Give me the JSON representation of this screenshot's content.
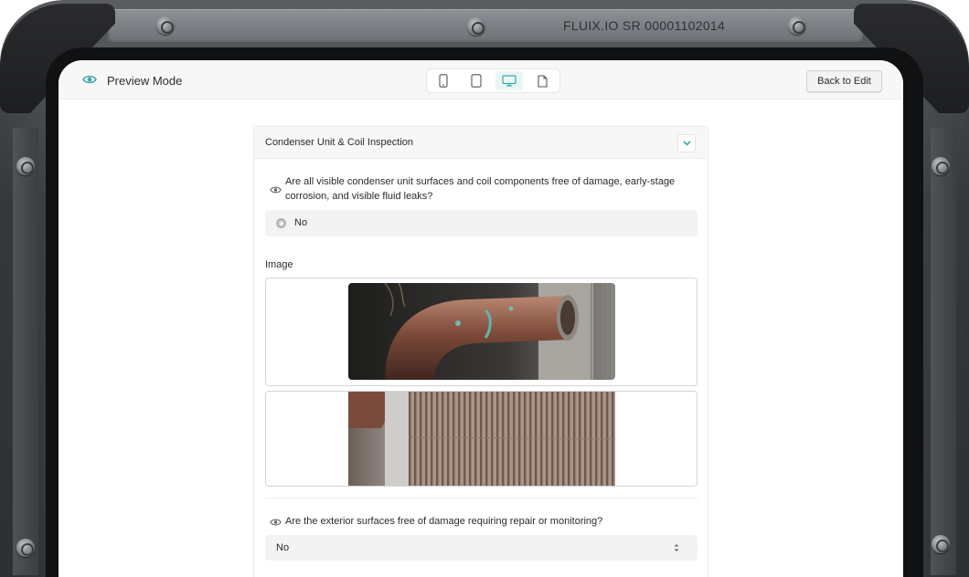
{
  "device": {
    "serial": "FLUIX.IO  SR 00001102014"
  },
  "topbar": {
    "mode_label": "Preview Mode",
    "device_options": [
      "phone",
      "tablet",
      "desktop",
      "document"
    ],
    "active_device": "desktop",
    "back_label": "Back to Edit"
  },
  "section": {
    "title": "Condenser Unit & Coil Inspection",
    "question1": {
      "text": "Are all visible condenser unit surfaces and coil components free of damage, early-stage corrosion, and visible fluid leaks?",
      "answer": "No"
    },
    "image_label": "Image",
    "question2": {
      "text": "Are the exterior surfaces free of damage requiring repair or monitoring?",
      "selected": "No"
    }
  },
  "colors": {
    "accent": "#3aa7a6",
    "frame_dark": "#34373b",
    "panel_bg": "#f7f7f7"
  }
}
